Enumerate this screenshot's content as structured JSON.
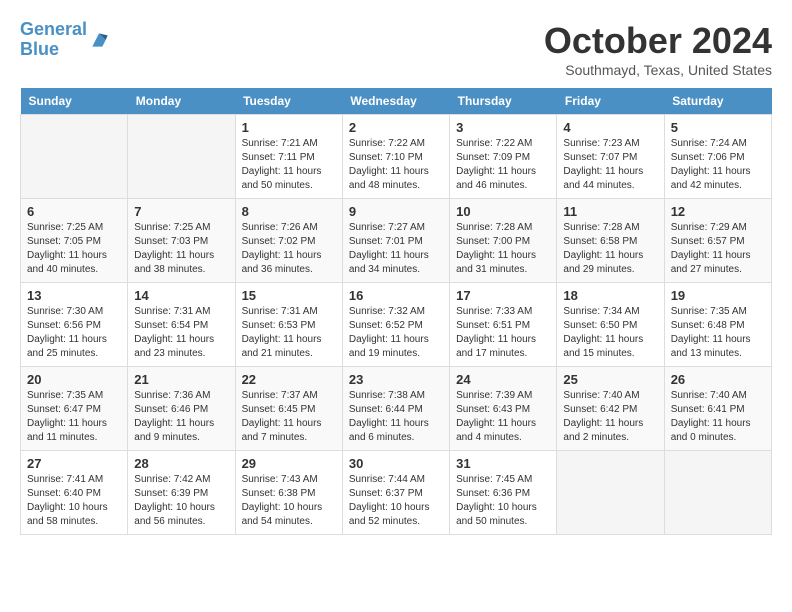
{
  "header": {
    "logo_line1": "General",
    "logo_line2": "Blue",
    "month_title": "October 2024",
    "subtitle": "Southmayd, Texas, United States"
  },
  "days_of_week": [
    "Sunday",
    "Monday",
    "Tuesday",
    "Wednesday",
    "Thursday",
    "Friday",
    "Saturday"
  ],
  "weeks": [
    [
      {
        "day": "",
        "info": ""
      },
      {
        "day": "",
        "info": ""
      },
      {
        "day": "1",
        "info": "Sunrise: 7:21 AM\nSunset: 7:11 PM\nDaylight: 11 hours and 50 minutes."
      },
      {
        "day": "2",
        "info": "Sunrise: 7:22 AM\nSunset: 7:10 PM\nDaylight: 11 hours and 48 minutes."
      },
      {
        "day": "3",
        "info": "Sunrise: 7:22 AM\nSunset: 7:09 PM\nDaylight: 11 hours and 46 minutes."
      },
      {
        "day": "4",
        "info": "Sunrise: 7:23 AM\nSunset: 7:07 PM\nDaylight: 11 hours and 44 minutes."
      },
      {
        "day": "5",
        "info": "Sunrise: 7:24 AM\nSunset: 7:06 PM\nDaylight: 11 hours and 42 minutes."
      }
    ],
    [
      {
        "day": "6",
        "info": "Sunrise: 7:25 AM\nSunset: 7:05 PM\nDaylight: 11 hours and 40 minutes."
      },
      {
        "day": "7",
        "info": "Sunrise: 7:25 AM\nSunset: 7:03 PM\nDaylight: 11 hours and 38 minutes."
      },
      {
        "day": "8",
        "info": "Sunrise: 7:26 AM\nSunset: 7:02 PM\nDaylight: 11 hours and 36 minutes."
      },
      {
        "day": "9",
        "info": "Sunrise: 7:27 AM\nSunset: 7:01 PM\nDaylight: 11 hours and 34 minutes."
      },
      {
        "day": "10",
        "info": "Sunrise: 7:28 AM\nSunset: 7:00 PM\nDaylight: 11 hours and 31 minutes."
      },
      {
        "day": "11",
        "info": "Sunrise: 7:28 AM\nSunset: 6:58 PM\nDaylight: 11 hours and 29 minutes."
      },
      {
        "day": "12",
        "info": "Sunrise: 7:29 AM\nSunset: 6:57 PM\nDaylight: 11 hours and 27 minutes."
      }
    ],
    [
      {
        "day": "13",
        "info": "Sunrise: 7:30 AM\nSunset: 6:56 PM\nDaylight: 11 hours and 25 minutes."
      },
      {
        "day": "14",
        "info": "Sunrise: 7:31 AM\nSunset: 6:54 PM\nDaylight: 11 hours and 23 minutes."
      },
      {
        "day": "15",
        "info": "Sunrise: 7:31 AM\nSunset: 6:53 PM\nDaylight: 11 hours and 21 minutes."
      },
      {
        "day": "16",
        "info": "Sunrise: 7:32 AM\nSunset: 6:52 PM\nDaylight: 11 hours and 19 minutes."
      },
      {
        "day": "17",
        "info": "Sunrise: 7:33 AM\nSunset: 6:51 PM\nDaylight: 11 hours and 17 minutes."
      },
      {
        "day": "18",
        "info": "Sunrise: 7:34 AM\nSunset: 6:50 PM\nDaylight: 11 hours and 15 minutes."
      },
      {
        "day": "19",
        "info": "Sunrise: 7:35 AM\nSunset: 6:48 PM\nDaylight: 11 hours and 13 minutes."
      }
    ],
    [
      {
        "day": "20",
        "info": "Sunrise: 7:35 AM\nSunset: 6:47 PM\nDaylight: 11 hours and 11 minutes."
      },
      {
        "day": "21",
        "info": "Sunrise: 7:36 AM\nSunset: 6:46 PM\nDaylight: 11 hours and 9 minutes."
      },
      {
        "day": "22",
        "info": "Sunrise: 7:37 AM\nSunset: 6:45 PM\nDaylight: 11 hours and 7 minutes."
      },
      {
        "day": "23",
        "info": "Sunrise: 7:38 AM\nSunset: 6:44 PM\nDaylight: 11 hours and 6 minutes."
      },
      {
        "day": "24",
        "info": "Sunrise: 7:39 AM\nSunset: 6:43 PM\nDaylight: 11 hours and 4 minutes."
      },
      {
        "day": "25",
        "info": "Sunrise: 7:40 AM\nSunset: 6:42 PM\nDaylight: 11 hours and 2 minutes."
      },
      {
        "day": "26",
        "info": "Sunrise: 7:40 AM\nSunset: 6:41 PM\nDaylight: 11 hours and 0 minutes."
      }
    ],
    [
      {
        "day": "27",
        "info": "Sunrise: 7:41 AM\nSunset: 6:40 PM\nDaylight: 10 hours and 58 minutes."
      },
      {
        "day": "28",
        "info": "Sunrise: 7:42 AM\nSunset: 6:39 PM\nDaylight: 10 hours and 56 minutes."
      },
      {
        "day": "29",
        "info": "Sunrise: 7:43 AM\nSunset: 6:38 PM\nDaylight: 10 hours and 54 minutes."
      },
      {
        "day": "30",
        "info": "Sunrise: 7:44 AM\nSunset: 6:37 PM\nDaylight: 10 hours and 52 minutes."
      },
      {
        "day": "31",
        "info": "Sunrise: 7:45 AM\nSunset: 6:36 PM\nDaylight: 10 hours and 50 minutes."
      },
      {
        "day": "",
        "info": ""
      },
      {
        "day": "",
        "info": ""
      }
    ]
  ]
}
